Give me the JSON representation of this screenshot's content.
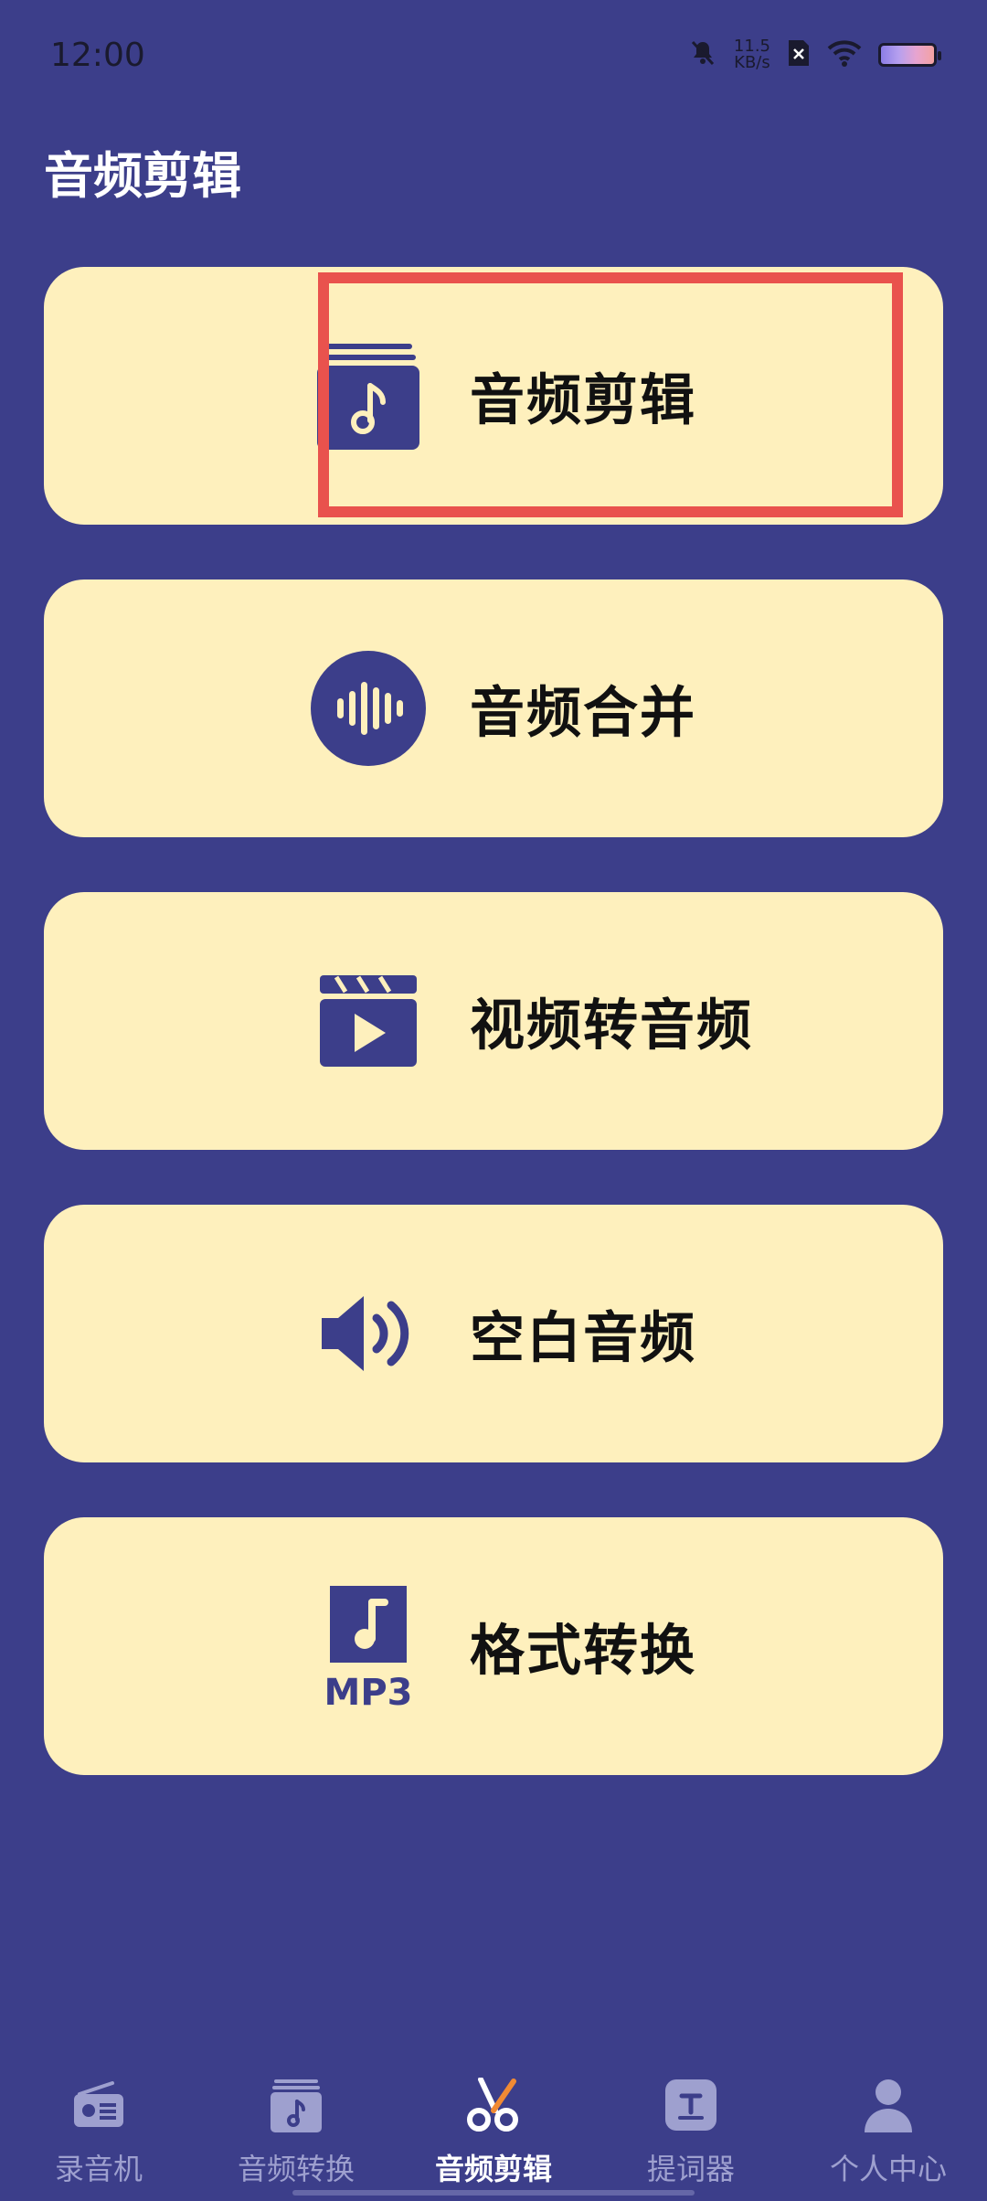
{
  "status_bar": {
    "time": "12:00",
    "speed_value": "11.5",
    "speed_unit": "KB/s"
  },
  "header": {
    "title": "音频剪辑"
  },
  "menu": {
    "items": [
      {
        "label": "音频剪辑",
        "icon": "music-album-icon"
      },
      {
        "label": "音频合并",
        "icon": "audio-wave-icon"
      },
      {
        "label": "视频转音频",
        "icon": "video-play-icon"
      },
      {
        "label": "空白音频",
        "icon": "speaker-icon"
      },
      {
        "label": "格式转换",
        "icon": "mp3-file-icon"
      }
    ]
  },
  "bottom_nav": {
    "items": [
      {
        "label": "录音机",
        "icon": "radio-icon"
      },
      {
        "label": "音频转换",
        "icon": "music-album-icon"
      },
      {
        "label": "音频剪辑",
        "icon": "scissors-icon",
        "active": true
      },
      {
        "label": "提词器",
        "icon": "teleprompter-icon"
      },
      {
        "label": "个人中心",
        "icon": "user-icon"
      }
    ]
  },
  "colors": {
    "background": "#3c3e8a",
    "card": "#fef0bd",
    "icon": "#3c3e8a",
    "highlight": "#e9524d",
    "nav_inactive": "#9ea0cf",
    "accent": "#f08a34"
  }
}
